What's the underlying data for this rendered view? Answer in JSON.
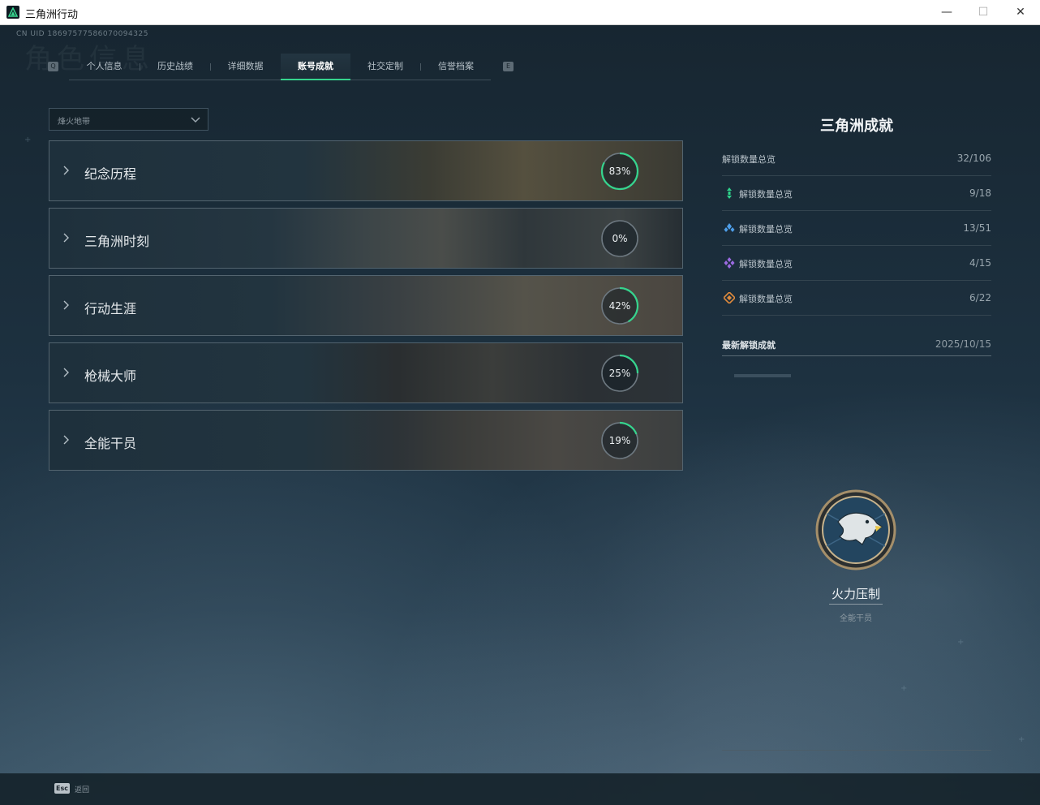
{
  "window": {
    "title": "三角洲行动",
    "minimize_glyph": "—",
    "maximize_glyph": "☐",
    "close_glyph": "✕"
  },
  "header": {
    "uid": "CN UID 18697577586070094325",
    "ghost_title": "角色信息",
    "tab_key_left": "Q",
    "tab_key_right": "E"
  },
  "tabs": [
    {
      "label": "个人信息",
      "active": false
    },
    {
      "label": "历史战绩",
      "active": false
    },
    {
      "label": "详细数据",
      "active": false
    },
    {
      "label": "账号成就",
      "active": true
    },
    {
      "label": "社交定制",
      "active": false
    },
    {
      "label": "信誉档案",
      "active": false
    }
  ],
  "mode_select": {
    "value": "烽火地带"
  },
  "categories": [
    {
      "name": "纪念历程",
      "progress": 83,
      "progress_label": "83%"
    },
    {
      "name": "三角洲时刻",
      "progress": 0,
      "progress_label": "0%"
    },
    {
      "name": "行动生涯",
      "progress": 42,
      "progress_label": "42%"
    },
    {
      "name": "枪械大师",
      "progress": 25,
      "progress_label": "25%"
    },
    {
      "name": "全能干员",
      "progress": 19,
      "progress_label": "19%"
    }
  ],
  "panel": {
    "title": "三角洲成就",
    "total": {
      "label": "解锁数量总览",
      "value": "32/106"
    },
    "tiers": [
      {
        "label": "解锁数量总览",
        "value": "9/18",
        "icon": "green-tier-icon",
        "color": "#2fd58c"
      },
      {
        "label": "解锁数量总览",
        "value": "13/51",
        "icon": "blue-tier-icon",
        "color": "#4e9ee8"
      },
      {
        "label": "解锁数量总览",
        "value": "4/15",
        "icon": "purple-tier-icon",
        "color": "#9b6ae0"
      },
      {
        "label": "解锁数量总览",
        "value": "6/22",
        "icon": "orange-tier-icon",
        "color": "#e08a3c"
      }
    ],
    "latest": {
      "label": "最新解锁成就",
      "date": "2025/10/15"
    },
    "achievement": {
      "name": "火力压制",
      "category": "全能干员",
      "icon": "eagle-emblem-icon"
    }
  },
  "footer": {
    "key": "Esc",
    "label": "返回"
  },
  "colors": {
    "accent": "#36d48e"
  }
}
